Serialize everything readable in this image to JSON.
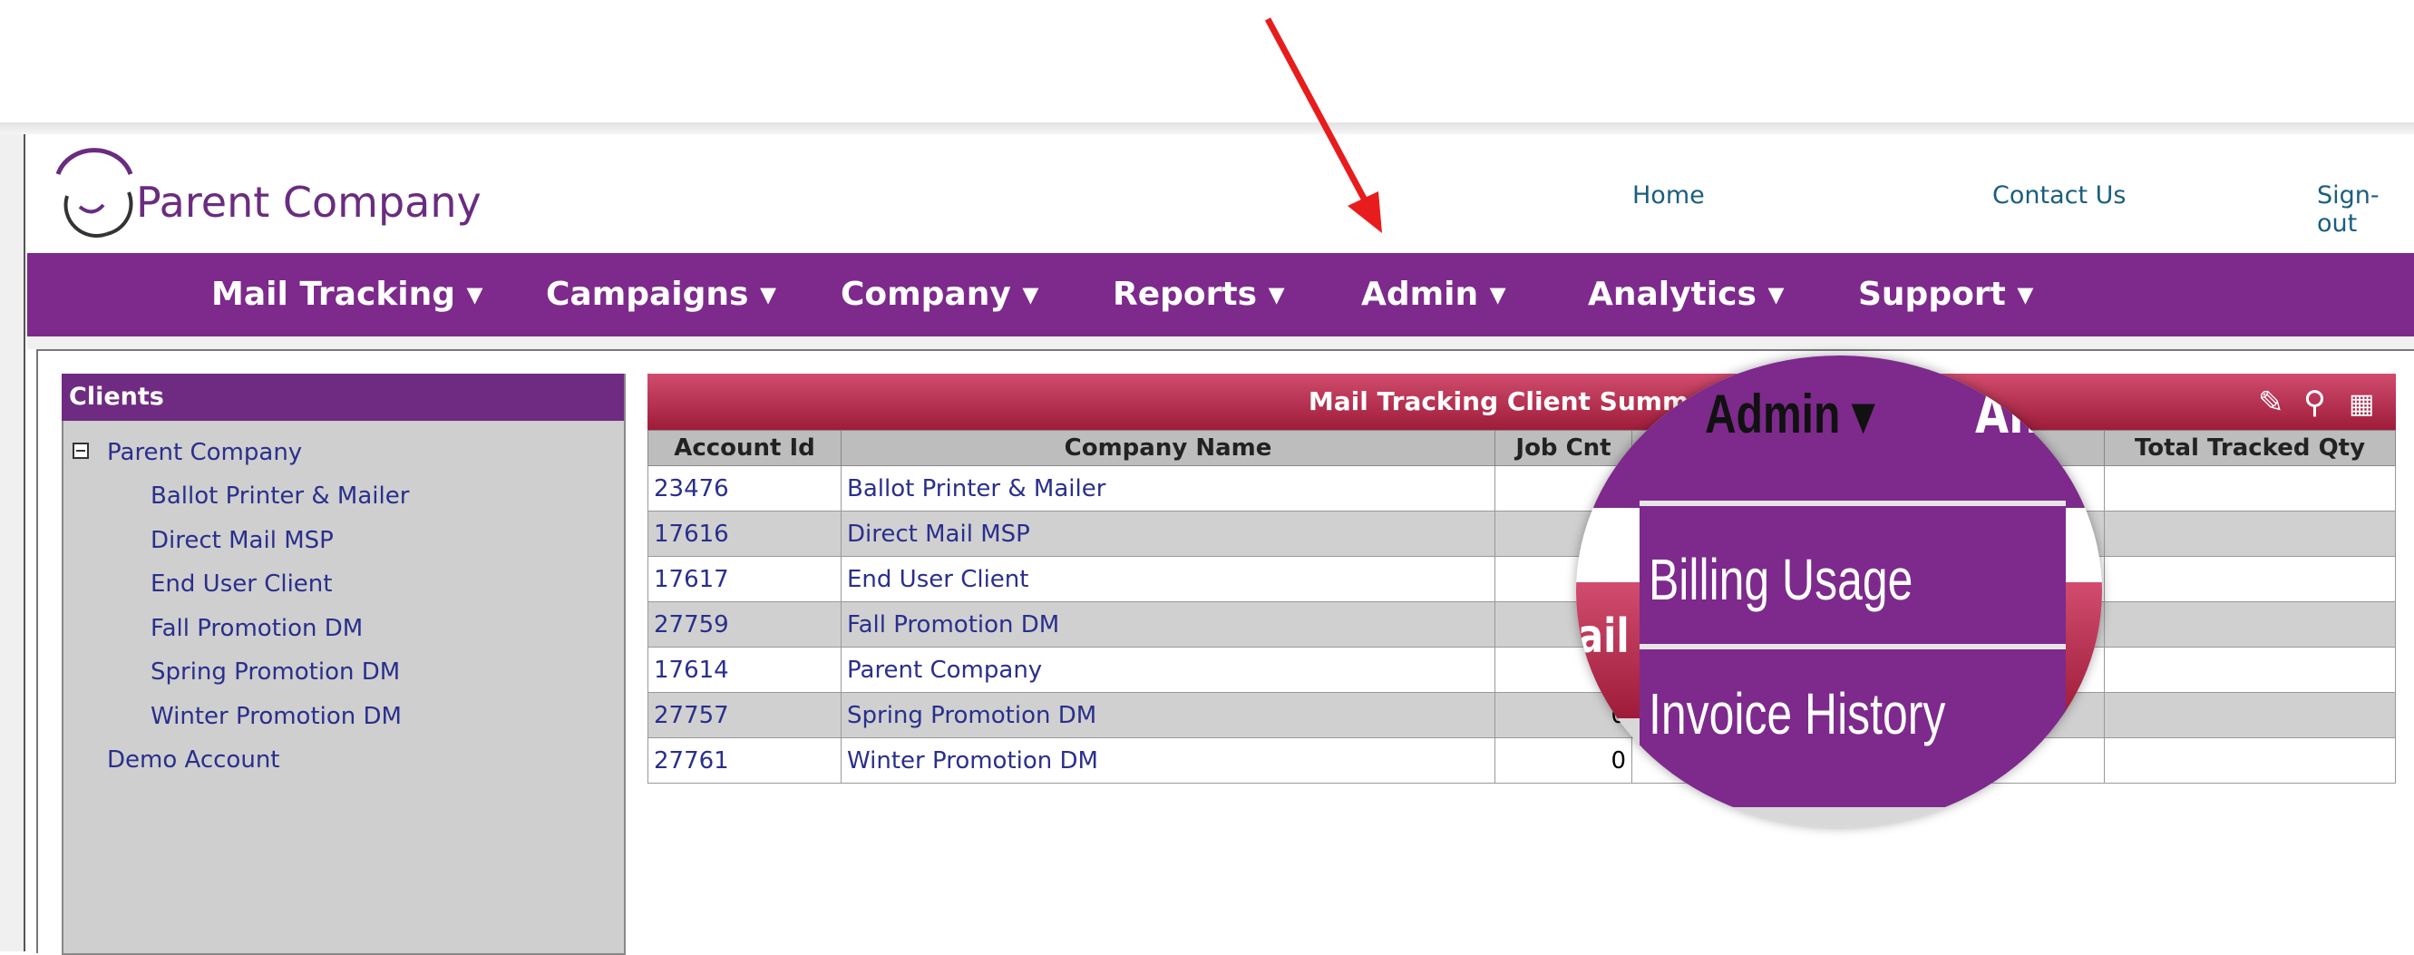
{
  "header": {
    "brand": "Parent Company",
    "links": [
      "Home",
      "Contact Us",
      "Sign-out"
    ]
  },
  "nav": {
    "items": [
      {
        "label": "Mail Tracking ▾"
      },
      {
        "label": "Campaigns ▾"
      },
      {
        "label": "Company ▾"
      },
      {
        "label": "Reports ▾"
      },
      {
        "label": "Admin ▾"
      },
      {
        "label": "Analytics ▾"
      },
      {
        "label": "Support ▾"
      }
    ]
  },
  "clients": {
    "title": "Clients",
    "root": "Parent Company",
    "children": [
      "Ballot Printer & Mailer",
      "Direct Mail MSP",
      "End User Client",
      "Fall Promotion DM",
      "Spring Promotion DM",
      "Winter Promotion DM"
    ],
    "other": "Demo Account"
  },
  "summary": {
    "title": "Mail Tracking Client Summary",
    "columns": [
      "Account Id",
      "Company Name",
      "Job Cnt",
      "",
      "",
      "Total Tracked Qty"
    ],
    "rows": [
      {
        "account_id": "23476",
        "company": "Ballot Printer & Mailer",
        "job_cnt": ""
      },
      {
        "account_id": "17616",
        "company": "Direct Mail MSP",
        "job_cnt": ""
      },
      {
        "account_id": "17617",
        "company": "End User Client",
        "job_cnt": ""
      },
      {
        "account_id": "27759",
        "company": "Fall Promotion DM",
        "job_cnt": ""
      },
      {
        "account_id": "17614",
        "company": "Parent Company",
        "job_cnt": ""
      },
      {
        "account_id": "27757",
        "company": "Spring Promotion DM",
        "job_cnt": "0"
      },
      {
        "account_id": "27761",
        "company": "Winter Promotion DM",
        "job_cnt": "0"
      }
    ]
  },
  "magnifier": {
    "nav_label": "Admin ▾",
    "nav_next": "An",
    "items": [
      "Billing Usage",
      "Invoice History"
    ],
    "partial_text": "ail"
  },
  "colors": {
    "nav_purple": "#7d2a8c",
    "grid_red": "#b52a4c",
    "arrow_red": "#e81c1c"
  }
}
